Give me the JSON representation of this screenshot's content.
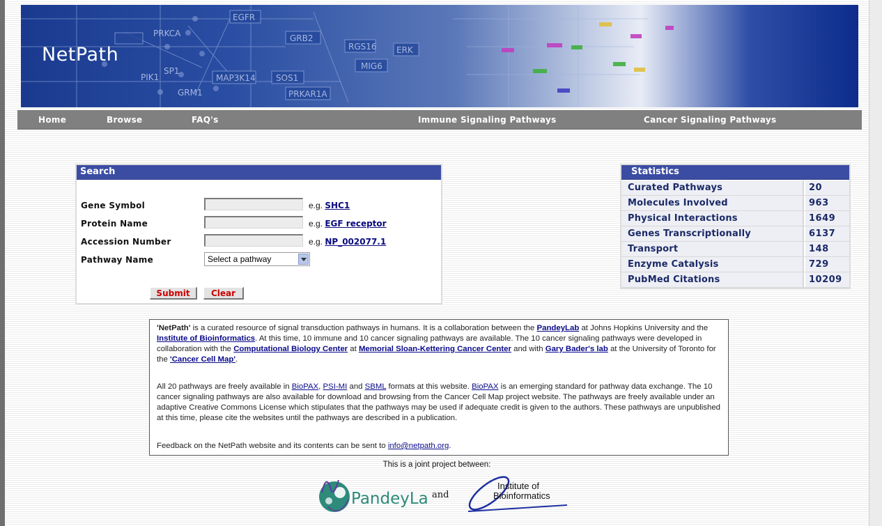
{
  "site": {
    "title": "NetPath"
  },
  "banner_labels": [
    "EGFR",
    "PRKCA",
    "GRB2",
    "RGS16",
    "ERK",
    "MIG6",
    "SOS1",
    "PRKAR1A",
    "MAP3K14",
    "SP1",
    "PIK1",
    "GRM1"
  ],
  "nav": [
    {
      "label": "Home"
    },
    {
      "label": "Browse"
    },
    {
      "label": "FAQ's"
    },
    {
      "label": "Immune Signaling Pathways"
    },
    {
      "label": "Cancer Signaling Pathways"
    }
  ],
  "search": {
    "heading": "Search",
    "fields": [
      {
        "label": "Gene Symbol",
        "value": "",
        "eg_prefix": "e.g.",
        "example": "SHC1"
      },
      {
        "label": "Protein Name",
        "value": "",
        "eg_prefix": "e.g.",
        "example": "EGF receptor"
      },
      {
        "label": "Accession Number",
        "value": "",
        "eg_prefix": "e.g.",
        "example": "NP_002077.1"
      }
    ],
    "pathway_label": "Pathway Name",
    "pathway_selected": "Select a pathway",
    "submit_label": "Submit",
    "clear_label": "Clear"
  },
  "statistics": {
    "heading": "Statistics",
    "rows": [
      {
        "label": "Curated Pathways",
        "value": "20"
      },
      {
        "label": "Molecules Involved",
        "value": "963"
      },
      {
        "label": "Physical Interactions",
        "value": "1649"
      },
      {
        "label": "Genes Transcriptionally Regulated",
        "value": "6137"
      },
      {
        "label": "Transport",
        "value": "148"
      },
      {
        "label": "Enzyme Catalysis",
        "value": "729"
      },
      {
        "label": "PubMed Citations",
        "value": "10209"
      }
    ]
  },
  "info": {
    "p1": {
      "t1": "'NetPath'",
      "t2": " is a curated resource of signal transduction pathways in humans. It is a collaboration between the ",
      "l1": "PandeyLab",
      "t3": " at Johns Hopkins University and the ",
      "l2": "Institute of Bioinformatics",
      "t4": ". At this time, 10 immune and 10 cancer signaling pathways are available. The 10 cancer signaling pathways were developed in collaboration with the ",
      "l3": "Computational Biology Center",
      "t5": " at ",
      "l4": "Memorial Sloan-Kettering Cancer Center",
      "t6": " and with ",
      "l5": "Gary Bader's lab",
      "t7": " at the University of Toronto for the ",
      "l6": "'Cancer Cell Map'",
      "t8": "."
    },
    "p2": {
      "t1": "All 20 pathways are freely available in ",
      "l1": "BioPAX",
      "t2": ", ",
      "l2": "PSI-MI",
      "t3": " and ",
      "l3": "SBML",
      "t4": " formats at this website. ",
      "l4": "BioPAX",
      "t5": " is an emerging standard for pathway data exchange. The 10 cancer signaling pathways are also available for download and browsing from the Cancer Cell Map project website. The pathways are freely available under an adaptive Creative Commons License which stipulates that the pathways may be used if adequate credit is given to the authors. These pathways are unpublished at this time, please cite the websites until the pathways are described in a publication."
    },
    "p3": {
      "t1": "Feedback on the NetPath website and its contents can be sent to ",
      "l1": "info@netpath.org",
      "t2": "."
    }
  },
  "footer": {
    "joint_text": "This is a joint project between:",
    "pandey_logo_text": "PandeyLab",
    "and_text": "and",
    "ib_logo_line1": "Institute of",
    "ib_logo_line2": "Bioinformatics"
  },
  "colors": {
    "nav_bg": "#808080",
    "panel_header": "#3b4da3",
    "link": "#0a0a80",
    "button_text": "#cc0000"
  }
}
